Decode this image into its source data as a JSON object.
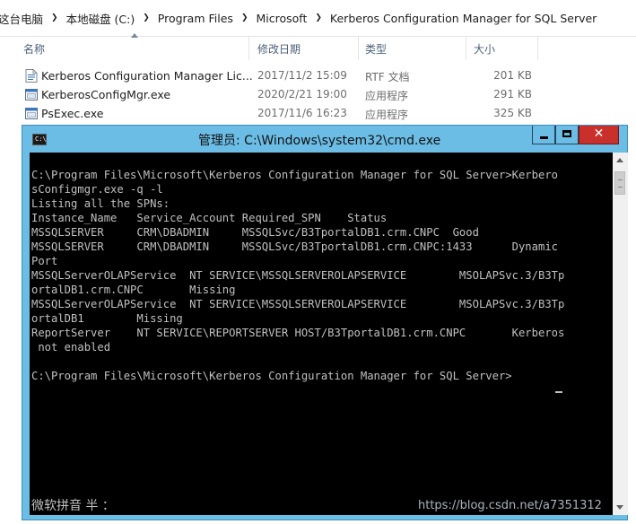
{
  "breadcrumb": [
    "这台电脑",
    "本地磁盘 (C:)",
    "Program Files",
    "Microsoft",
    "Kerberos Configuration Manager for SQL Server"
  ],
  "columns": {
    "name": "名称",
    "modified": "修改日期",
    "type": "类型",
    "size": "大小"
  },
  "files": [
    {
      "name": "Kerberos Configuration Manager Lic...",
      "modified": "2017/11/2 15:09",
      "type": "RTF 文档",
      "size": "201 KB",
      "icon": "rtf-document-icon"
    },
    {
      "name": "KerberosConfigMgr.exe",
      "modified": "2020/2/21 19:00",
      "type": "应用程序",
      "size": "291 KB",
      "icon": "application-icon"
    },
    {
      "name": "PsExec.exe",
      "modified": "2017/11/6 16:23",
      "type": "应用程序",
      "size": "325 KB",
      "icon": "application-icon"
    }
  ],
  "cmd": {
    "title": "管理员: C:\\Windows\\system32\\cmd.exe",
    "icon_text": "C:\\",
    "buttons": {
      "minimize": "minimize-icon",
      "maximize": "maximize-icon",
      "close": "✕"
    },
    "output": "C:\\Program Files\\Microsoft\\Kerberos Configuration Manager for SQL Server>Kerbero\nsConfigmgr.exe -q -l\nListing all the SPNs:\nInstance_Name   Service_Account Required_SPN    Status\nMSSQLSERVER     CRM\\DBADMIN     MSSQLSvc/B3TportalDB1.crm.CNPC  Good\nMSSQLSERVER     CRM\\DBADMIN     MSSQLSvc/B3TportalDB1.crm.CNPC:1433      Dynamic\nPort\nMSSQLServerOLAPService  NT SERVICE\\MSSQLSERVEROLAPSERVICE        MSOLAPSvc.3/B3Tp\nortalDB1.crm.CNPC       Missing\nMSSQLServerOLAPService  NT SERVICE\\MSSQLSERVEROLAPSERVICE        MSOLAPSvc.3/B3Tp\nortalDB1        Missing\nReportServer    NT SERVICE\\REPORTSERVER HOST/B3TportalDB1.crm.CNPC       Kerberos\n not enabled\n\nC:\\Program Files\\Microsoft\\Kerberos Configuration Manager for SQL Server>",
    "ime_status": "微软拼音 半 ："
  },
  "watermark": "https://blog.csdn.net/a7351312",
  "colors": {
    "accent": "#6bbde6",
    "close": "#c9302c",
    "console_bg": "#000000",
    "console_fg": "#c0c0c0"
  }
}
